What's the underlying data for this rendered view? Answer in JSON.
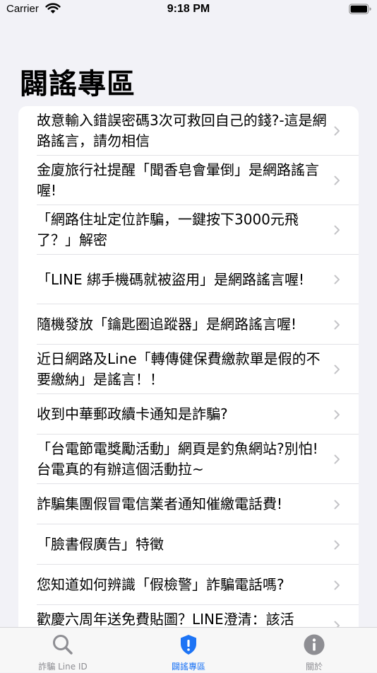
{
  "status_bar": {
    "carrier": "Carrier",
    "time": "9:18 PM"
  },
  "page_title": "闢謠專區",
  "articles": [
    "故意輸入錯誤密碼3次可救回自己的錢?-這是網路謠言，請勿相信",
    "金廈旅行社提醒「聞香皂會暈倒」是網路謠言喔!",
    "「網路住址定位詐騙，一鍵按下3000元飛了？」解密",
    "「LINE 綁手機碼就被盜用」是網路謠言喔!",
    "隨機發放「鑰匙圈追蹤器」是網路謠言喔!",
    "近日網路及Line「轉傳健保費繳款單是假的不要繳納」是謠言！！",
    "收到中華郵政續卡通知是詐騙?",
    "「台電節電獎勵活動」網頁是釣魚網站?別怕!台電真的有辦這個活動拉~",
    "詐騙集團假冒電信業者通知催繳電話費!",
    "「臉書假廣告」特徵",
    "您知道如何辨識「假檢警」詐騙電話嗎?",
    "歡慶六周年送免費貼圖？LINE澄清：該活"
  ],
  "tabs": [
    {
      "label": "詐騙 Line ID",
      "icon": "search-icon"
    },
    {
      "label": "闢謠專區",
      "icon": "shield-icon"
    },
    {
      "label": "關於",
      "icon": "info-icon"
    }
  ],
  "colors": {
    "accent": "#1d74f5",
    "inactive": "#8e8e93",
    "background": "#f2f2f7"
  }
}
